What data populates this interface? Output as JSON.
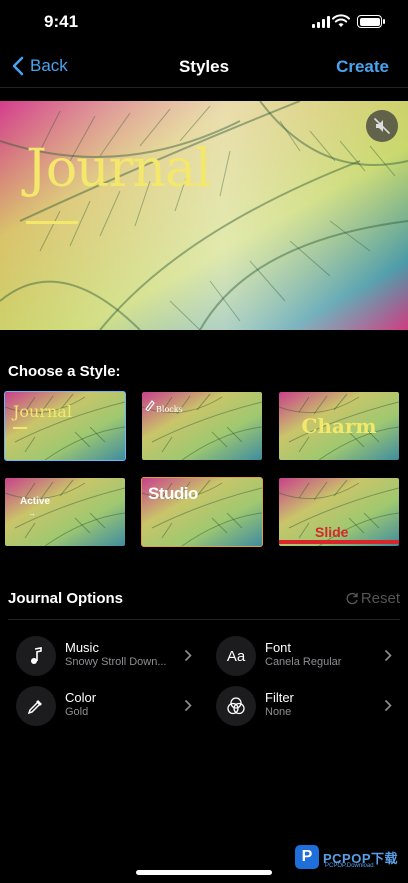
{
  "status_bar": {
    "time": "9:41"
  },
  "nav": {
    "back_label": "Back",
    "title": "Styles",
    "create_label": "Create"
  },
  "preview": {
    "title": "Journal"
  },
  "styles_section": {
    "label": "Choose a Style:"
  },
  "styles": [
    {
      "label": "Journal",
      "selected": true
    },
    {
      "label": "Blocks",
      "selected": false
    },
    {
      "label": "Charm",
      "selected": false
    },
    {
      "label": "Active",
      "selected": false
    },
    {
      "label": "Studio",
      "selected": false
    },
    {
      "label": "Slide",
      "selected": false
    }
  ],
  "options": {
    "header": "Journal Options",
    "reset_label": "Reset",
    "items": [
      {
        "name": "Music",
        "value": "Snowy Stroll Down...",
        "icon": "music-note-icon"
      },
      {
        "name": "Font",
        "value": "Canela Regular",
        "icon": "font-icon"
      },
      {
        "name": "Color",
        "value": "Gold",
        "icon": "eyedropper-icon"
      },
      {
        "name": "Filter",
        "value": "None",
        "icon": "filter-circles-icon"
      }
    ],
    "font_icon_text": "Aa"
  },
  "watermark": {
    "text": "PCPOP下载",
    "sub": "PCPOP.Download"
  },
  "colors": {
    "accent": "#4aa3f0",
    "title_gold": "#f3e86b",
    "selected_outline": "#6ab7ff",
    "studio_outline": "#e0a03c",
    "slide_red": "#d8262a"
  }
}
